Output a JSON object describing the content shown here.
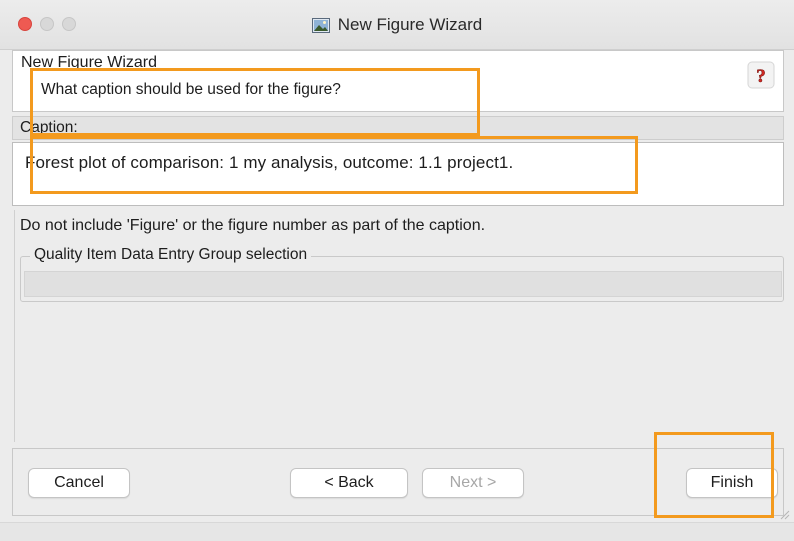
{
  "window": {
    "title": "New Figure Wizard"
  },
  "header": {
    "title": "New Figure Wizard",
    "question": "What caption should be used for the figure?"
  },
  "caption": {
    "label": "Caption:",
    "value": "Forest plot of comparison: 1 my analysis, outcome: 1.1 project1."
  },
  "hint": "Do not include 'Figure' or the figure number as part of the caption.",
  "group": {
    "title": "Quality Item Data Entry Group selection"
  },
  "buttons": {
    "cancel": "Cancel",
    "back": "< Back",
    "next": "Next >",
    "finish": "Finish"
  },
  "colors": {
    "highlight": "#f39a1e",
    "close": "#ee5a52",
    "disabled_text": "#a7a7a7"
  },
  "icons": [
    "window-image-icon",
    "help-icon",
    "resize-grip-icon"
  ]
}
